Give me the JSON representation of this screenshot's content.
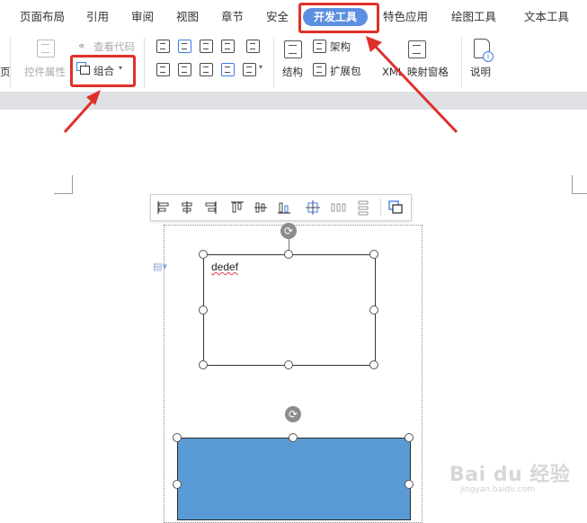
{
  "tabs": [
    {
      "label": "页面布局"
    },
    {
      "label": "引用"
    },
    {
      "label": "审阅"
    },
    {
      "label": "视图"
    },
    {
      "label": "章节"
    },
    {
      "label": "安全"
    },
    {
      "label": "开发工具",
      "active": true
    },
    {
      "label": "特色应用"
    },
    {
      "label": "绘图工具"
    },
    {
      "label": "文本工具"
    }
  ],
  "ribbon": {
    "edge_label": "页",
    "control_props_label": "控件属性",
    "view_code_label": "查看代码",
    "group_label": "组合",
    "structure_label": "结构",
    "schema_label": "架构",
    "expansion_pack_label": "扩展包",
    "xml_map_label": "XML 映射窗格",
    "help_label": "说明"
  },
  "document": {
    "textbox_text": "dedef"
  },
  "watermark": {
    "brand": "Bai du 经验",
    "url": "jingyan.baidu.com"
  },
  "colors": {
    "active_tab": "#5b8fe0",
    "highlight": "#e0302a",
    "shape_fill": "#5b9bd5"
  }
}
